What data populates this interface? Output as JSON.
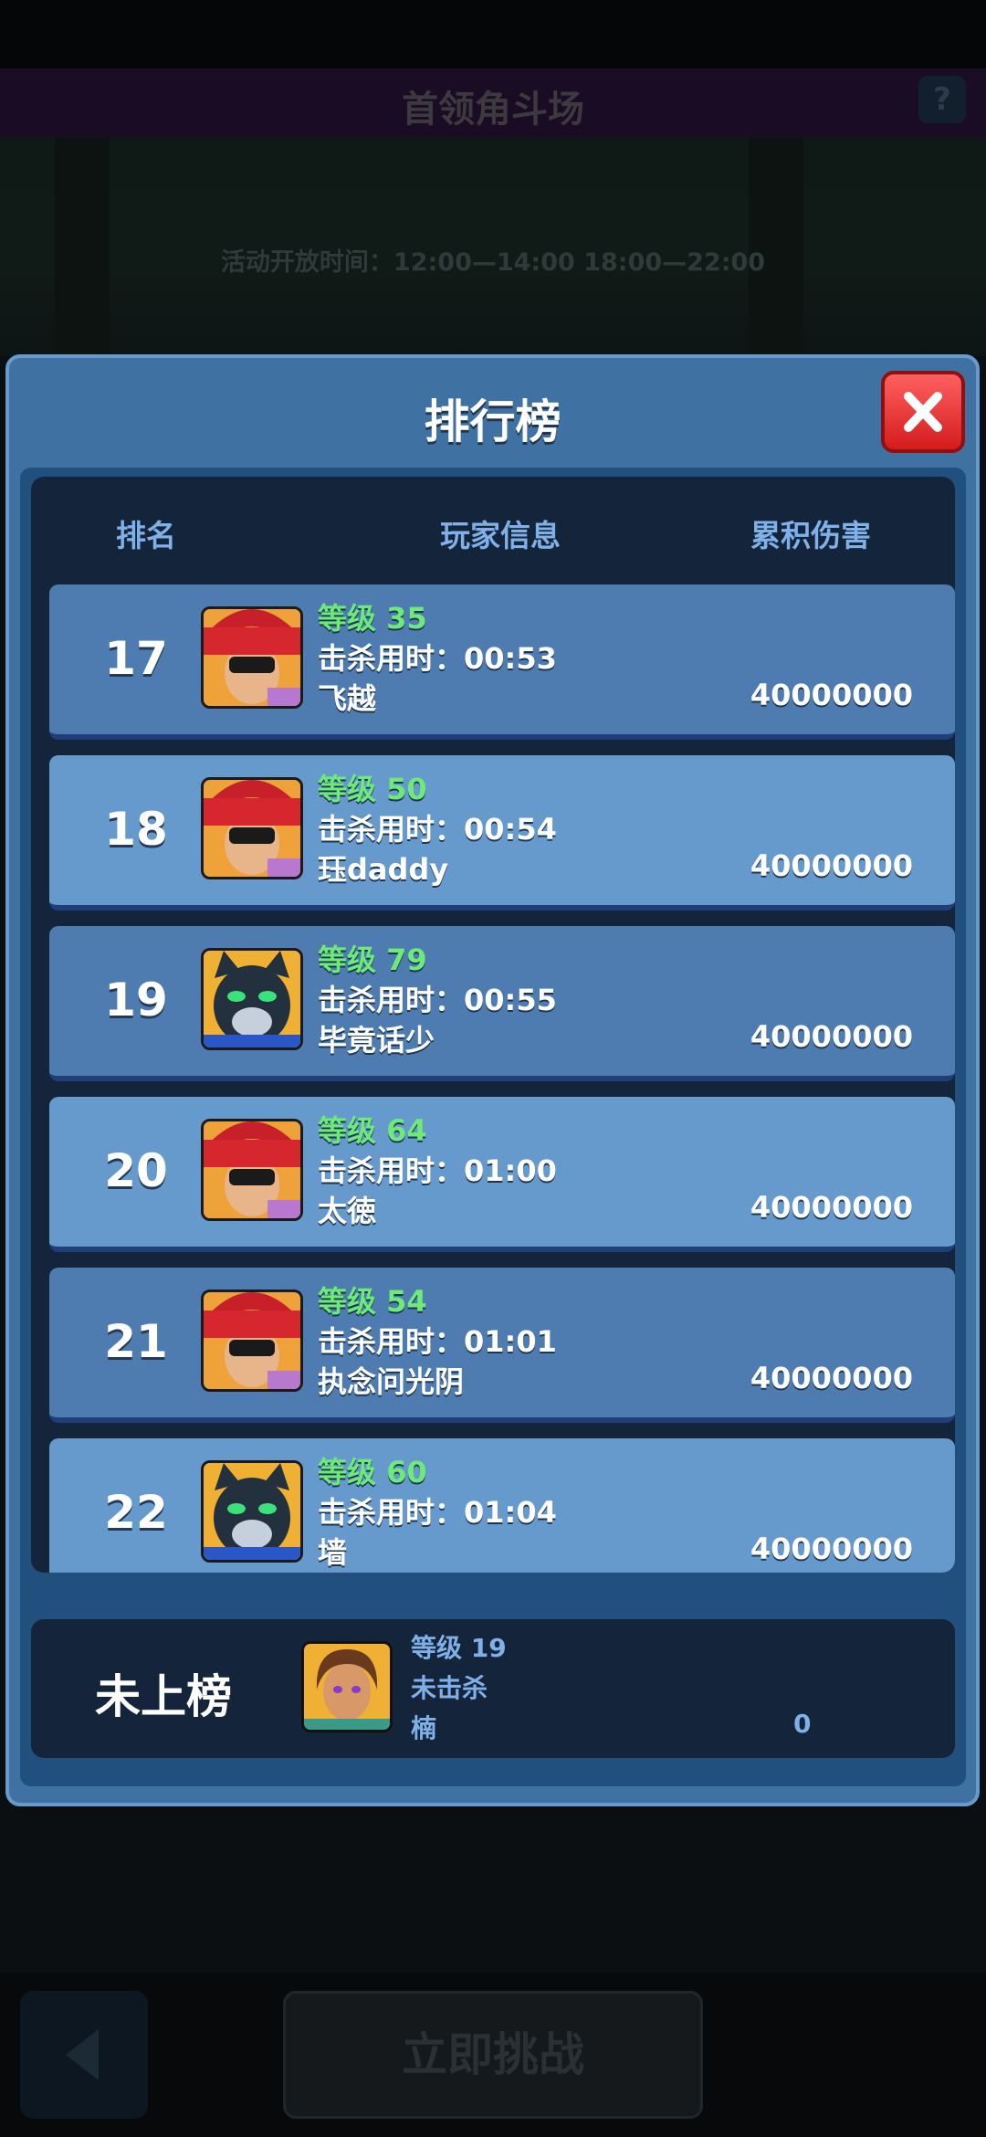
{
  "header": {
    "title": "首领角斗场",
    "help_label": "?"
  },
  "event": {
    "open_time": "活动开放时间：12:00—14:00 18:00—22:00"
  },
  "leaderboard": {
    "title": "排行榜",
    "columns": {
      "rank": "排名",
      "player_info": "玩家信息",
      "damage": "累积伤害"
    },
    "rows": [
      {
        "rank": "17",
        "avatar": "red-hat-hero-avatar",
        "level": "等级 35",
        "kill_time": "击杀用时：00:53",
        "name": "飞越",
        "damage": "40000000"
      },
      {
        "rank": "18",
        "avatar": "red-hat-hero-avatar",
        "level": "等级 50",
        "kill_time": "击杀用时：00:54",
        "name": "珏daddy",
        "damage": "40000000"
      },
      {
        "rank": "19",
        "avatar": "panther-hero-avatar",
        "level": "等级 79",
        "kill_time": "击杀用时：00:55",
        "name": "毕竟话少",
        "damage": "40000000"
      },
      {
        "rank": "20",
        "avatar": "red-hat-hero-avatar",
        "level": "等级 64",
        "kill_time": "击杀用时：01:00",
        "name": "太徳",
        "damage": "40000000"
      },
      {
        "rank": "21",
        "avatar": "red-hat-hero-avatar",
        "level": "等级 54",
        "kill_time": "击杀用时：01:01",
        "name": "执念问光阴",
        "damage": "40000000"
      },
      {
        "rank": "22",
        "avatar": "panther-hero-avatar",
        "level": "等级 60",
        "kill_time": "击杀用时：01:04",
        "name": "墙",
        "damage": "40000000"
      }
    ],
    "my_entry": {
      "rank": "未上榜",
      "avatar": "girl-hero-avatar",
      "level": "等级 19",
      "kill_time": "未击杀",
      "name": "楠",
      "damage": "0"
    }
  },
  "footer": {
    "challenge_label": "立即挑战"
  }
}
